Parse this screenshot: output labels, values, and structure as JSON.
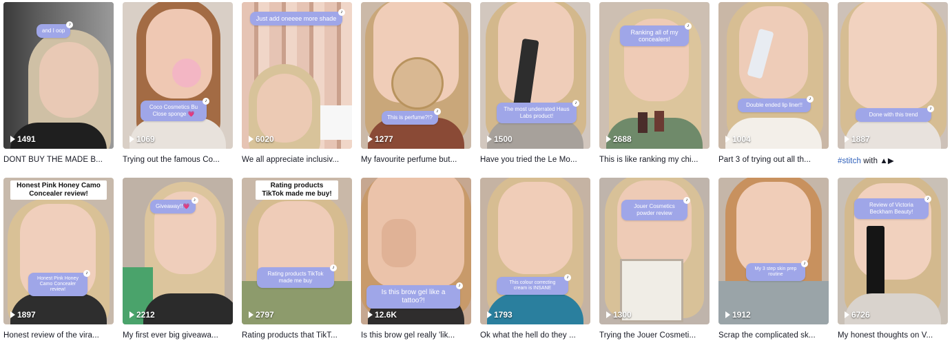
{
  "videos_row1": [
    {
      "caption": "and I oop",
      "views": "1491",
      "desc": "DONT BUY THE MADE B..."
    },
    {
      "caption": "Coco Cosmetics Bu Close sponge 💗",
      "views": "1069",
      "desc": "Trying out the famous Co..."
    },
    {
      "caption": "Just add oneeee more shade",
      "views": "6020",
      "desc": "We all appreciate inclusiv..."
    },
    {
      "caption": "This is perfume?!?",
      "views": "1277",
      "desc": "My favourite perfume but..."
    },
    {
      "caption": "The most underrated Haus Labs product!",
      "views": "1500",
      "desc": "Have you tried the Le Mo..."
    },
    {
      "caption": "Ranking all of my concealers!",
      "views": "2688",
      "desc": "This is like ranking my chi..."
    },
    {
      "caption": "Double ended lip liner!!",
      "views": "1004",
      "desc": "Part 3 of trying out all th..."
    },
    {
      "caption": "Done with this trend",
      "views": "1887",
      "desc_hashtag": "#stitch",
      "desc": " with ▲▶"
    }
  ],
  "videos_row2": [
    {
      "title_banner": "Honest Pink Honey Camo Concealer review!",
      "caption": "Honest Pink Honey Camo Concealer review!",
      "views": "1897",
      "desc": "Honest review of the vira..."
    },
    {
      "caption": "Giveaway!!💗",
      "views": "2212",
      "desc": "My first ever big giveawa..."
    },
    {
      "title_banner": "Rating products TikTok made me buy!",
      "caption": "Rating products TikTok made me buy",
      "views": "2797",
      "desc": "Rating products that TikT..."
    },
    {
      "caption": "Is this brow gel like a tattoo?!",
      "views": "12.6K",
      "desc": "Is this brow gel really 'lik..."
    },
    {
      "caption": "This colour correcting cream is INSANE",
      "views": "1793",
      "desc": "Ok what the hell do they ..."
    },
    {
      "caption": "Jouer Cosmetics powder review",
      "views": "1300",
      "desc": "Trying the Jouer Cosmeti..."
    },
    {
      "caption": "My 3 step skin prep routine",
      "views": "1912",
      "desc": "Scrap the complicated sk..."
    },
    {
      "caption": "Review of Victoria Beckham Beauty!",
      "views": "6726",
      "desc": "My honest thoughts on V..."
    }
  ],
  "colors": {
    "bubble": "#9fa6e8",
    "hashtag": "#2b5db9",
    "text": "#161823"
  },
  "icons": {
    "play": "play-icon",
    "tiktok": "tiktok-logo-icon"
  }
}
